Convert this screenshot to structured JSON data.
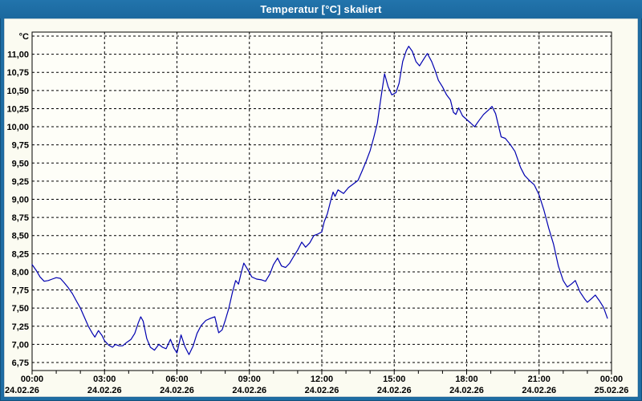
{
  "window": {
    "title": "Temperatur [°C] skaliert"
  },
  "colors": {
    "titlebar_bg": "#1e6da4",
    "frame": "#1e6da4",
    "frame_edge": "#14517c",
    "content_bg": "#fbfbf1",
    "plot_bg": "#fefef8",
    "grid": "#000000",
    "axis": "#000000",
    "label_text": "#000000",
    "title_text": "#ffffff",
    "line": "#0000b0"
  },
  "chart_data": {
    "type": "line",
    "title": "Temperatur [°C] skaliert",
    "y_unit_label": "°C",
    "grid": "dotted",
    "legend": "none",
    "y_axis": {
      "min": 6.75,
      "max": 11.25,
      "tick_step": 0.25,
      "tick_labels_top_to_bottom": [
        "11,00",
        "10,75",
        "10,50",
        "10,25",
        "10,00",
        "9,75",
        "9,50",
        "9,25",
        "9,00",
        "8,75",
        "8,50",
        "8,25",
        "8,00",
        "7,75",
        "7,50",
        "7,25",
        "7,00",
        "6,75"
      ]
    },
    "x_axis": {
      "start_hour": 0,
      "end_hour": 24,
      "minor_tick_hours": 1,
      "major_tick_hours": 3,
      "major_ticks": [
        {
          "time": "00:00",
          "date": "24.02.26"
        },
        {
          "time": "03:00",
          "date": "24.02.26"
        },
        {
          "time": "06:00",
          "date": "24.02.26"
        },
        {
          "time": "09:00",
          "date": "24.02.26"
        },
        {
          "time": "12:00",
          "date": "24.02.26"
        },
        {
          "time": "15:00",
          "date": "24.02.26"
        },
        {
          "time": "18:00",
          "date": "24.02.26"
        },
        {
          "time": "21:00",
          "date": "24.02.26"
        },
        {
          "time": "00:00",
          "date": "25.02.26"
        }
      ]
    },
    "series": [
      {
        "color": "#0000b0",
        "points": [
          [
            0,
            8.1
          ],
          [
            0.17,
            8.02
          ],
          [
            0.33,
            7.93
          ],
          [
            0.5,
            7.87
          ],
          [
            0.67,
            7.88
          ],
          [
            0.83,
            7.9
          ],
          [
            1,
            7.92
          ],
          [
            1.17,
            7.91
          ],
          [
            1.33,
            7.85
          ],
          [
            1.5,
            7.78
          ],
          [
            1.67,
            7.7
          ],
          [
            1.83,
            7.6
          ],
          [
            2,
            7.5
          ],
          [
            2.17,
            7.37
          ],
          [
            2.33,
            7.25
          ],
          [
            2.5,
            7.15
          ],
          [
            2.6,
            7.1
          ],
          [
            2.75,
            7.19
          ],
          [
            2.9,
            7.12
          ],
          [
            3,
            7.05
          ],
          [
            3.17,
            6.99
          ],
          [
            3.33,
            6.96
          ],
          [
            3.45,
            7
          ],
          [
            3.6,
            6.98
          ],
          [
            3.75,
            6.98
          ],
          [
            3.93,
            7.03
          ],
          [
            4.1,
            7.07
          ],
          [
            4.25,
            7.15
          ],
          [
            4.4,
            7.3
          ],
          [
            4.5,
            7.38
          ],
          [
            4.6,
            7.32
          ],
          [
            4.75,
            7.08
          ],
          [
            4.9,
            6.96
          ],
          [
            5.07,
            6.92
          ],
          [
            5.25,
            7
          ],
          [
            5.4,
            6.96
          ],
          [
            5.55,
            6.94
          ],
          [
            5.73,
            7.07
          ],
          [
            5.87,
            6.95
          ],
          [
            6,
            6.88
          ],
          [
            6.17,
            7.13
          ],
          [
            6.33,
            6.97
          ],
          [
            6.5,
            6.86
          ],
          [
            6.67,
            6.98
          ],
          [
            6.83,
            7.15
          ],
          [
            7,
            7.26
          ],
          [
            7.2,
            7.33
          ],
          [
            7.4,
            7.36
          ],
          [
            7.57,
            7.38
          ],
          [
            7.73,
            7.16
          ],
          [
            7.87,
            7.2
          ],
          [
            8,
            7.33
          ],
          [
            8.15,
            7.5
          ],
          [
            8.3,
            7.72
          ],
          [
            8.43,
            7.88
          ],
          [
            8.55,
            7.83
          ],
          [
            8.65,
            7.97
          ],
          [
            8.77,
            8.12
          ],
          [
            8.9,
            8.05
          ],
          [
            9.1,
            7.93
          ],
          [
            9.3,
            7.9
          ],
          [
            9.5,
            7.89
          ],
          [
            9.67,
            7.87
          ],
          [
            9.85,
            7.97
          ],
          [
            10,
            8.1
          ],
          [
            10.17,
            8.19
          ],
          [
            10.33,
            8.08
          ],
          [
            10.5,
            8.06
          ],
          [
            10.67,
            8.12
          ],
          [
            10.85,
            8.22
          ],
          [
            11,
            8.3
          ],
          [
            11.17,
            8.41
          ],
          [
            11.33,
            8.34
          ],
          [
            11.5,
            8.4
          ],
          [
            11.67,
            8.5
          ],
          [
            11.83,
            8.52
          ],
          [
            12,
            8.55
          ],
          [
            12.1,
            8.69
          ],
          [
            12.23,
            8.8
          ],
          [
            12.4,
            9.02
          ],
          [
            12.47,
            9.1
          ],
          [
            12.55,
            9.04
          ],
          [
            12.67,
            9.13
          ],
          [
            12.9,
            9.08
          ],
          [
            13.1,
            9.16
          ],
          [
            13.3,
            9.21
          ],
          [
            13.5,
            9.26
          ],
          [
            13.67,
            9.39
          ],
          [
            13.83,
            9.52
          ],
          [
            14,
            9.67
          ],
          [
            14.15,
            9.85
          ],
          [
            14.3,
            10.05
          ],
          [
            14.45,
            10.4
          ],
          [
            14.6,
            10.73
          ],
          [
            14.75,
            10.55
          ],
          [
            14.9,
            10.44
          ],
          [
            15.07,
            10.47
          ],
          [
            15.2,
            10.6
          ],
          [
            15.35,
            10.9
          ],
          [
            15.5,
            11.05
          ],
          [
            15.6,
            11.11
          ],
          [
            15.75,
            11.04
          ],
          [
            15.9,
            10.9
          ],
          [
            16.05,
            10.84
          ],
          [
            16.2,
            10.92
          ],
          [
            16.37,
            11.01
          ],
          [
            16.55,
            10.9
          ],
          [
            16.7,
            10.77
          ],
          [
            16.83,
            10.64
          ],
          [
            17,
            10.55
          ],
          [
            17.17,
            10.44
          ],
          [
            17.33,
            10.37
          ],
          [
            17.45,
            10.2
          ],
          [
            17.55,
            10.17
          ],
          [
            17.67,
            10.26
          ],
          [
            17.83,
            10.15
          ],
          [
            18,
            10.1
          ],
          [
            18.17,
            10.05
          ],
          [
            18.33,
            10
          ],
          [
            18.5,
            10.08
          ],
          [
            18.7,
            10.17
          ],
          [
            18.9,
            10.23
          ],
          [
            19.05,
            10.28
          ],
          [
            19.2,
            10.18
          ],
          [
            19.43,
            9.86
          ],
          [
            19.6,
            9.84
          ],
          [
            19.8,
            9.76
          ],
          [
            20,
            9.66
          ],
          [
            20.23,
            9.44
          ],
          [
            20.4,
            9.33
          ],
          [
            20.6,
            9.26
          ],
          [
            20.8,
            9.2
          ],
          [
            21,
            9.06
          ],
          [
            21.2,
            8.85
          ],
          [
            21.4,
            8.6
          ],
          [
            21.6,
            8.38
          ],
          [
            21.8,
            8.08
          ],
          [
            22,
            7.88
          ],
          [
            22.17,
            7.79
          ],
          [
            22.33,
            7.83
          ],
          [
            22.5,
            7.88
          ],
          [
            22.7,
            7.72
          ],
          [
            22.9,
            7.62
          ],
          [
            23,
            7.58
          ],
          [
            23.17,
            7.63
          ],
          [
            23.33,
            7.68
          ],
          [
            23.5,
            7.6
          ],
          [
            23.67,
            7.51
          ],
          [
            23.83,
            7.36
          ]
        ]
      }
    ]
  }
}
